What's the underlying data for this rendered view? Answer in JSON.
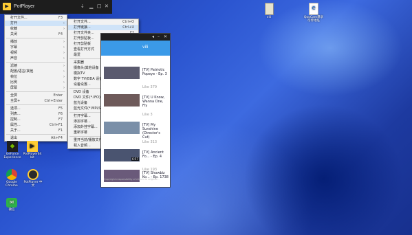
{
  "player": {
    "title": "PotPlayer",
    "logo": "▶"
  },
  "main_menu": [
    {
      "label": "打开文件...",
      "shortcut": "F3"
    },
    {
      "label": "打开",
      "shortcut": "",
      "arrow": true,
      "highlighted": true
    },
    {
      "label": "收藏",
      "shortcut": "",
      "arrow": true
    },
    {
      "label": "关闭",
      "shortcut": "F4"
    },
    {
      "sep": true
    },
    {
      "label": "播放",
      "shortcut": "",
      "arrow": true
    },
    {
      "label": "字幕",
      "shortcut": "",
      "arrow": true
    },
    {
      "label": "视频",
      "shortcut": "",
      "arrow": true
    },
    {
      "label": "声音",
      "shortcut": "",
      "arrow": true
    },
    {
      "sep": true
    },
    {
      "label": "滤镜",
      "shortcut": "",
      "arrow": true
    },
    {
      "label": "配置/语言/其他",
      "shortcut": "",
      "arrow": true
    },
    {
      "label": "帧位",
      "shortcut": "",
      "arrow": true
    },
    {
      "label": "比例",
      "shortcut": "",
      "arrow": true
    },
    {
      "label": "屏幕",
      "shortcut": "",
      "arrow": true
    },
    {
      "sep": true
    },
    {
      "label": "全屏",
      "shortcut": "Enter"
    },
    {
      "label": "全屏+",
      "shortcut": "Ctrl+Enter"
    },
    {
      "sep": true
    },
    {
      "label": "选项...",
      "shortcut": "F5"
    },
    {
      "label": "列表...",
      "shortcut": "F6"
    },
    {
      "label": "控制...",
      "shortcut": "F7"
    },
    {
      "label": "属性...",
      "shortcut": "Ctrl+F1"
    },
    {
      "label": "关于...",
      "shortcut": "F1"
    },
    {
      "sep": true
    },
    {
      "label": "退出",
      "shortcut": "Alt+F4"
    }
  ],
  "sub_menu": [
    {
      "label": "打开文件...",
      "shortcut": "Ctrl+O"
    },
    {
      "label": "打开链接...",
      "shortcut": "Ctrl+U",
      "highlighted": true
    },
    {
      "label": "打开文件夹...",
      "shortcut": "F2"
    },
    {
      "label": "打开剪贴板...",
      "shortcut": "Alt+F12"
    },
    {
      "label": "打开剪贴板",
      "shortcut": "Ctrl+V"
    },
    {
      "label": "查看打开方式",
      "shortcut": "",
      "arrow": true
    },
    {
      "label": "最爱",
      "shortcut": "",
      "arrow": true
    },
    {
      "sep": true
    },
    {
      "label": "采集器",
      "shortcut": "Ctrl+S"
    },
    {
      "label": "摄像头/其他设备",
      "shortcut": "Ctrl+J"
    },
    {
      "label": "模拟TV",
      "shortcut": "Ctrl+W"
    },
    {
      "label": "数字 TV(BDA 设备)",
      "shortcut": "Ctrl+K"
    },
    {
      "label": "设备设置...",
      "shortcut": "Alt+D"
    },
    {
      "sep": true
    },
    {
      "label": "DVD 设备",
      "shortcut": "Ctrl+D"
    },
    {
      "label": "DVD 文件(*.IFO)...",
      "shortcut": "Ctrl+I"
    },
    {
      "label": "蓝光设备",
      "shortcut": "Ctrl+Alt+D"
    },
    {
      "label": "蓝光文件(*.MPLS)...",
      "shortcut": ""
    },
    {
      "sep": true
    },
    {
      "label": "打开字幕...",
      "shortcut": "Alt+O"
    },
    {
      "label": "添加字幕...",
      "shortcut": ""
    },
    {
      "label": "添加外挂字幕...",
      "shortcut": ""
    },
    {
      "label": "重新字幕",
      "shortcut": "Ctrl+Alt+Y"
    },
    {
      "sep": true
    },
    {
      "label": "重开当前/播放文件",
      "shortcut": "Ctrl+Y"
    },
    {
      "label": "载入音频...",
      "shortcut": ""
    }
  ],
  "panel": {
    "header": "vili",
    "items": [
      {
        "title": "[TV] Patriotic Popeye - Ep. 3",
        "like": "Like 379",
        "thumb": "#5a5a6e",
        "duration": ""
      },
      {
        "title": "[TV] U Know, Wanna One, Fly",
        "like": "Like 3",
        "thumb": "#6e5a5a",
        "duration": ""
      },
      {
        "title": "[TV] My Sunshine (Director's Cut)",
        "like": "Like 313",
        "thumb": "#7a8fa8",
        "duration": ""
      },
      {
        "title": "[TV] Ancient Fo... - Ep. 4",
        "like": "Like 193",
        "thumb": "#4a5470",
        "duration": "6:57"
      },
      {
        "title": "[TV] Showbiz Ko... - Ep. 1738",
        "like": "",
        "thumb": "#6a5a7a",
        "duration": ""
      }
    ],
    "copyright": "Copyright responsibility of clips is in original..."
  },
  "desktop_icons": [
    {
      "label": "vili",
      "color": "#e4e0c8",
      "glyph": "▮"
    },
    {
      "label": "QooCam暴享可传地址",
      "color": "#ffffff",
      "glyph": "e"
    },
    {
      "label": "GeForce Experience",
      "color": "#222222",
      "glyph": "◆"
    },
    {
      "label": "PotPlayer64 bit",
      "color": "#222222",
      "glyph": "▶"
    },
    {
      "label": "Google Chrome",
      "color": "#dd4b39",
      "glyph": "●"
    },
    {
      "label": "PotPlayer 中文",
      "color": "#333333",
      "glyph": "▶"
    },
    {
      "label": "微信",
      "color": "#2fb14b",
      "glyph": "✉"
    }
  ]
}
